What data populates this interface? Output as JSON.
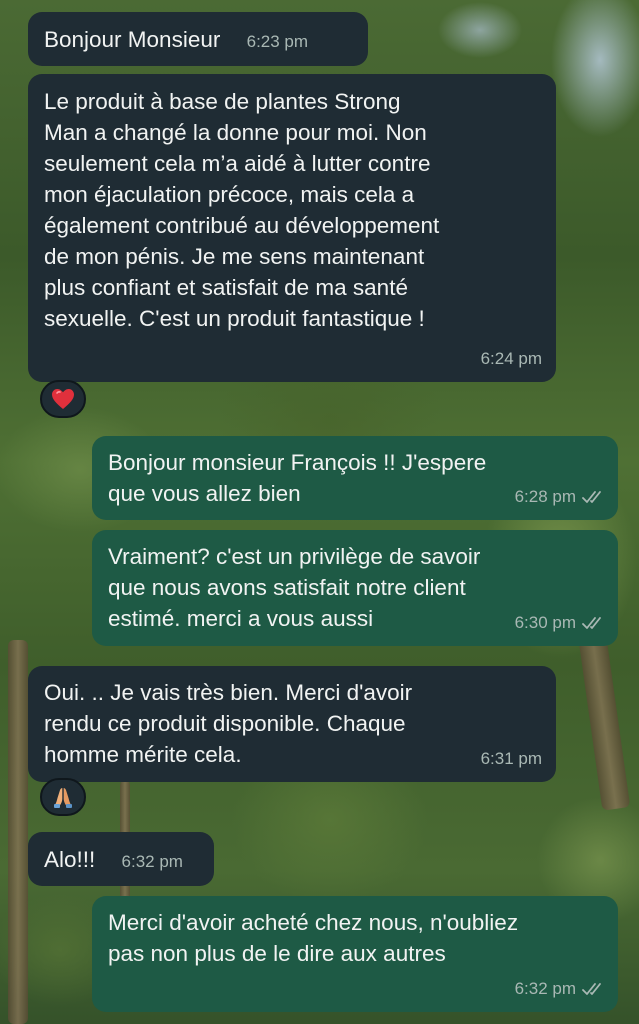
{
  "chat": {
    "messages": [
      {
        "direction": "incoming",
        "text": "Bonjour Monsieur",
        "time": "6:23 pm"
      },
      {
        "direction": "incoming",
        "text": "Le produit à base de plantes Strong\nMan a changé la donne pour moi. Non\nseulement cela m’a aidé à lutter contre\nmon éjaculation précoce, mais cela a\négalement contribué au développement\nde mon pénis. Je me sens maintenant\nplus confiant et satisfait de ma santé\nsexuelle. C'est un produit fantastique !",
        "time": "6:24 pm",
        "reaction": "heart-emoji"
      },
      {
        "direction": "outgoing",
        "text": "Bonjour monsieur  François  !! J'espere\nque vous allez bien",
        "time": "6:28 pm",
        "status": "read"
      },
      {
        "direction": "outgoing",
        "text": "Vraiment? c'est un privilège de savoir\nque nous avons satisfait notre client\nestimé. merci  a vous aussi",
        "time": "6:30 pm",
        "status": "read"
      },
      {
        "direction": "incoming",
        "text": "Oui. .. Je vais très bien. Merci d'avoir\nrendu ce produit disponible. Chaque\nhomme mérite cela.",
        "time": "6:31 pm",
        "reaction": "folded-hands-emoji"
      },
      {
        "direction": "incoming",
        "text": "Alo!!!",
        "time": "6:32 pm"
      },
      {
        "direction": "outgoing",
        "text": "Merci d'avoir acheté chez nous, n'oubliez\npas non plus de le dire aux autres",
        "time": "6:32 pm",
        "status": "read"
      }
    ]
  },
  "colors": {
    "incoming_bubble": "#1f2c34",
    "outgoing_bubble": "#1e5a45",
    "read_ticks": "#a9b8b4",
    "heart": "#e0303c"
  }
}
